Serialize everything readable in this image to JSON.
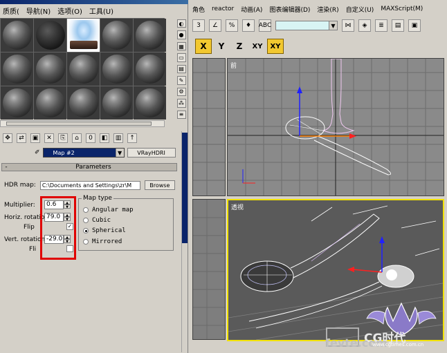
{
  "left_menu": [
    "质质(",
    "导航(N)",
    "选项(O)",
    "工具(U)"
  ],
  "material_editor": {
    "map_name": "Map #2",
    "map_type_button": "VRayHDRI",
    "rollout_title": "Parameters",
    "hdr_map_label": "HDR map:",
    "hdr_map_path": "C:\\Documents and Settings\\zr\\M",
    "browse_label": "Browse",
    "multiplier_label": "Multiplier:",
    "multiplier_value": "0.6",
    "horiz_rotation_label": "Horiz. rotation",
    "horiz_rotation_value": "79.0",
    "flip_label": "Flip",
    "flip_checked": "✓",
    "vert_rotation_label": "Vert. rotation:",
    "vert_rotation_value": "-29.0",
    "flip2_label": "Fli",
    "map_type_group": "Map type",
    "map_types": [
      "Angular map",
      "Cubic",
      "Spherical",
      "Mirrored"
    ],
    "selected_map_type": "Spherical"
  },
  "right_menu": [
    "角色",
    "reactor",
    "动画(A)",
    "图表编辑器(D)",
    "渲染(R)",
    "自定义(U)",
    "MAXScript(M)"
  ],
  "axis_buttons": [
    "X",
    "Y",
    "Z",
    "XY",
    "XY"
  ],
  "viewports": {
    "front_label": "前",
    "perspective_label": "透视"
  },
  "watermark": {
    "brand": "CG时代",
    "site": "fevte.com",
    "url": "www.cgtimes.com.cn"
  }
}
